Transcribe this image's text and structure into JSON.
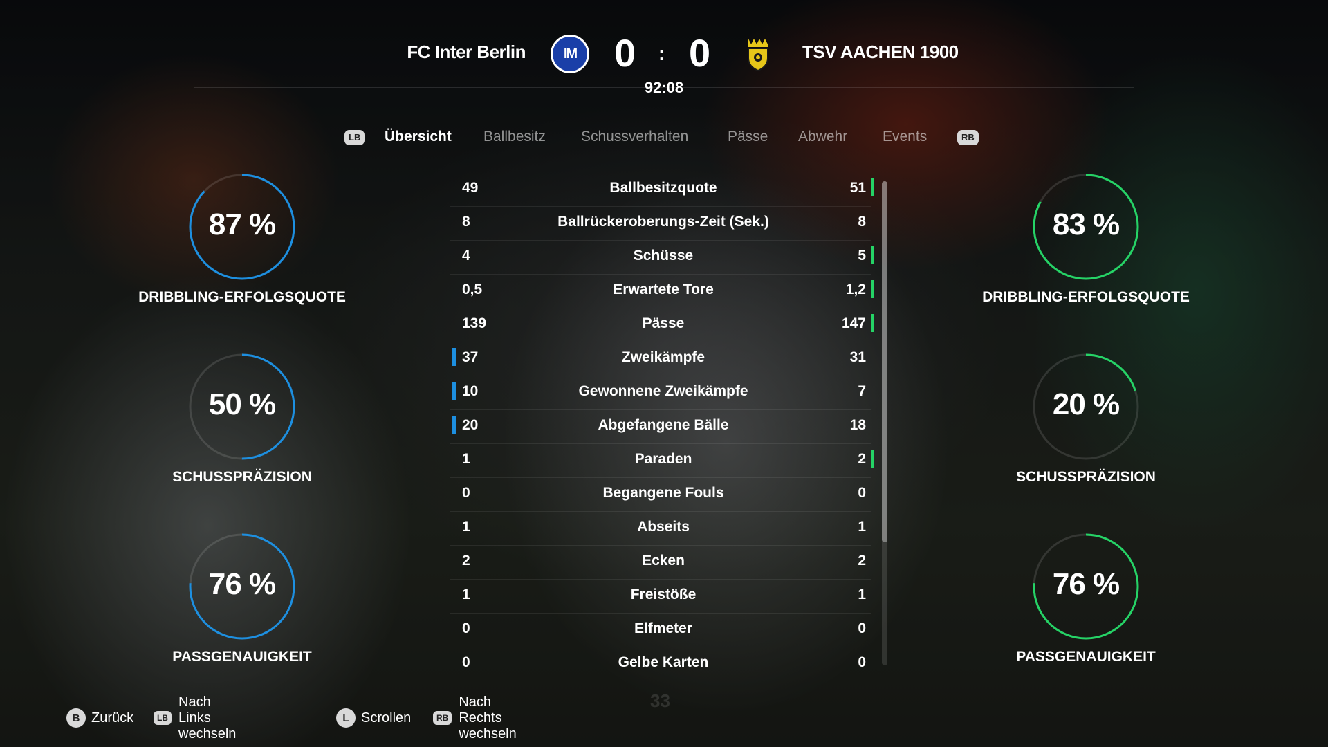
{
  "match": {
    "home_team": "FC Inter Berlin",
    "away_team": "TSV AACHEN 1900",
    "home_crest_text": "IM",
    "home_score": "0",
    "away_score": "0",
    "score_separator": ":",
    "clock": "92:08"
  },
  "tabs": {
    "prev_chip": "LB",
    "next_chip": "RB",
    "items": [
      {
        "label": "Übersicht",
        "active": true
      },
      {
        "label": "Ballbesitz",
        "active": false
      },
      {
        "label": "Schussverhalten",
        "active": false
      },
      {
        "label": "Pässe",
        "active": false
      },
      {
        "label": "Abwehr",
        "active": false
      },
      {
        "label": "Events",
        "active": false
      }
    ]
  },
  "stats": [
    {
      "label": "Ballbesitzquote",
      "home": "49",
      "away": "51",
      "lead": "away"
    },
    {
      "label": "Ballrückeroberungs-Zeit (Sek.)",
      "home": "8",
      "away": "8",
      "lead": "none"
    },
    {
      "label": "Schüsse",
      "home": "4",
      "away": "5",
      "lead": "away"
    },
    {
      "label": "Erwartete Tore",
      "home": "0,5",
      "away": "1,2",
      "lead": "away"
    },
    {
      "label": "Pässe",
      "home": "139",
      "away": "147",
      "lead": "away"
    },
    {
      "label": "Zweikämpfe",
      "home": "37",
      "away": "31",
      "lead": "home"
    },
    {
      "label": "Gewonnene Zweikämpfe",
      "home": "10",
      "away": "7",
      "lead": "home"
    },
    {
      "label": "Abgefangene Bälle",
      "home": "20",
      "away": "18",
      "lead": "home"
    },
    {
      "label": "Paraden",
      "home": "1",
      "away": "2",
      "lead": "away"
    },
    {
      "label": "Begangene Fouls",
      "home": "0",
      "away": "0",
      "lead": "none"
    },
    {
      "label": "Abseits",
      "home": "1",
      "away": "1",
      "lead": "none"
    },
    {
      "label": "Ecken",
      "home": "2",
      "away": "2",
      "lead": "none"
    },
    {
      "label": "Freistöße",
      "home": "1",
      "away": "1",
      "lead": "none"
    },
    {
      "label": "Elfmeter",
      "home": "0",
      "away": "0",
      "lead": "none"
    },
    {
      "label": "Gelbe Karten",
      "home": "0",
      "away": "0",
      "lead": "none"
    }
  ],
  "rings": {
    "home": [
      {
        "value": 87,
        "text": "87 %",
        "label": "DRIBBLING-ERFOLGSQUOTE"
      },
      {
        "value": 50,
        "text": "50 %",
        "label": "SCHUSSPRÄZISION"
      },
      {
        "value": 76,
        "text": "76 %",
        "label": "PASSGENAUIGKEIT"
      }
    ],
    "away": [
      {
        "value": 83,
        "text": "83 %",
        "label": "DRIBBLING-ERFOLGSQUOTE"
      },
      {
        "value": 20,
        "text": "20 %",
        "label": "SCHUSSPRÄZISION"
      },
      {
        "value": 76,
        "text": "76 %",
        "label": "PASSGENAUIGKEIT"
      }
    ]
  },
  "colors": {
    "home_accent": "#1d8fe0",
    "away_accent": "#25d366"
  },
  "footer": {
    "back_btn": "B",
    "back_label": "Zurück",
    "left_chip": "LB",
    "left_label": "Nach Links wechseln",
    "scroll_btn": "L",
    "scroll_label": "Scrollen",
    "right_chip": "RB",
    "right_label": "Nach Rechts wechseln"
  },
  "background_number": "33"
}
